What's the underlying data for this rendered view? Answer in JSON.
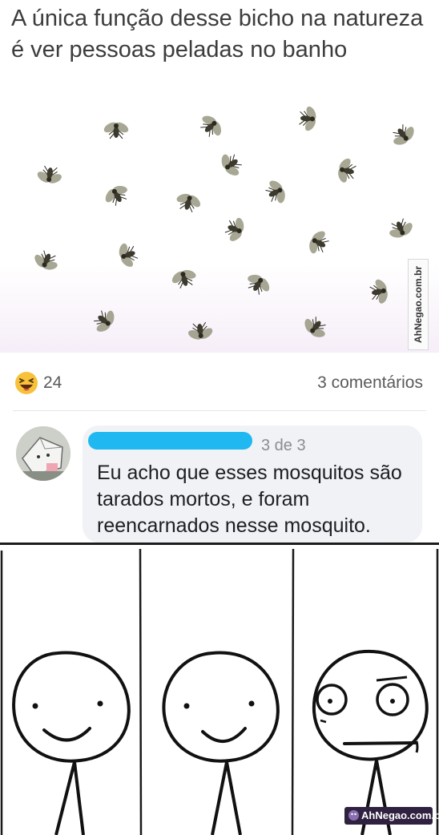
{
  "post": {
    "text": "A única função desse bicho na natureza é ver pessoas peladas no banho"
  },
  "watermark_side": "AhNegao.com.br",
  "stats": {
    "reaction_icon": "laughing-emoji",
    "reaction_count": "24",
    "comment_count": "3 comentários"
  },
  "comment": {
    "meta": "3 de 3",
    "text": "Eu acho que esses mosquitos são tarados mortos, e foram reencarnados nesse mosquito."
  },
  "watermark_corner": "AhNegao.com.br",
  "colors": {
    "redaction": "#1fb8f0",
    "bubble": "#f0f2f5",
    "emoji": "#f7c23a"
  }
}
